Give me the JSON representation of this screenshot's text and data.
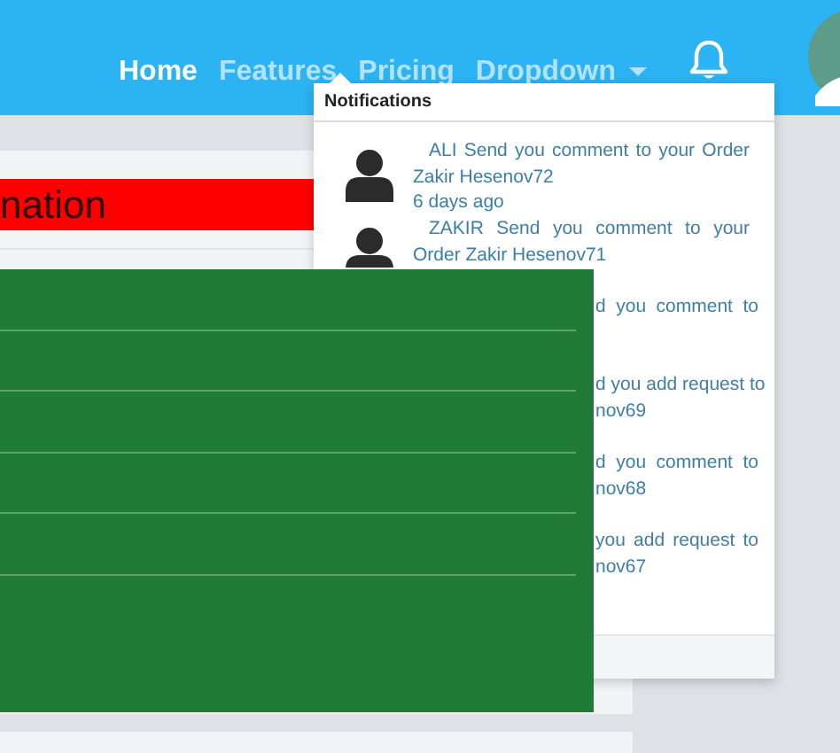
{
  "navbar": {
    "links": [
      {
        "label": "Home",
        "selected": true
      },
      {
        "label": "Features",
        "selected": false
      },
      {
        "label": "Pricing",
        "selected": false
      },
      {
        "label": "Dropdown",
        "selected": false
      }
    ]
  },
  "page": {
    "banner": "nation"
  },
  "notifications": {
    "title": "Notifications",
    "items": [
      {
        "kind": "full",
        "lines": [
          "ALI Send you comment to your Order",
          "Zakir Hesenov72"
        ],
        "time": "6 days ago"
      },
      {
        "kind": "full",
        "lines": [
          "ZAKIR Send you comment to your",
          "Order  Zakir Hesenov71"
        ]
      },
      {
        "kind": "partial",
        "lines": [
          "d you comment to"
        ]
      },
      {
        "kind": "partial",
        "lines": [
          "d you add request to",
          "nov69"
        ]
      },
      {
        "kind": "partial",
        "lines": [
          "d you comment to",
          "nov68"
        ]
      },
      {
        "kind": "partial",
        "lines": [
          "you add request to",
          "nov67"
        ]
      }
    ]
  }
}
